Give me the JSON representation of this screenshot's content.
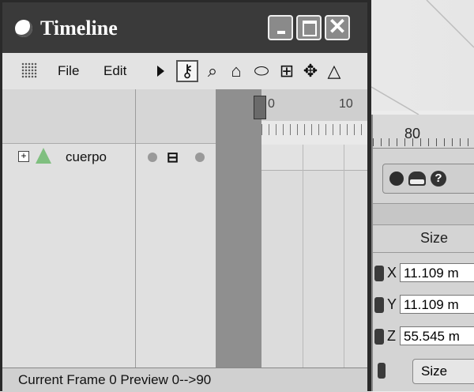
{
  "window": {
    "title": "Timeline",
    "buttons": {
      "minimize": "",
      "maximize": "",
      "close": "✕"
    }
  },
  "menu": {
    "file": "File",
    "edit": "Edit"
  },
  "toolbar": [
    {
      "icon": "key-icon",
      "glyph": "⚷",
      "active": true
    },
    {
      "icon": "magnifier-icon",
      "glyph": "🔍"
    },
    {
      "icon": "home-icon",
      "glyph": "⌂"
    },
    {
      "icon": "ellipse-icon",
      "glyph": "⬭"
    },
    {
      "icon": "frame-add-icon",
      "glyph": "⊞"
    },
    {
      "icon": "move-icon",
      "glyph": "✥"
    },
    {
      "icon": "triangle-icon",
      "glyph": "△"
    }
  ],
  "timeline": {
    "tick_0": "0",
    "tick_10": "10"
  },
  "tree": {
    "item_label": "cuerpo"
  },
  "status": {
    "text": "Current Frame  0  Preview  0-->90"
  },
  "right_panel": {
    "ruler_value": "80",
    "size_header": "Size",
    "fields": [
      {
        "axis": "X",
        "value": "11.109 m"
      },
      {
        "axis": "Y",
        "value": "11.109 m"
      },
      {
        "axis": "Z",
        "value": "55.545 m"
      }
    ],
    "size_dropdown": "Size"
  }
}
